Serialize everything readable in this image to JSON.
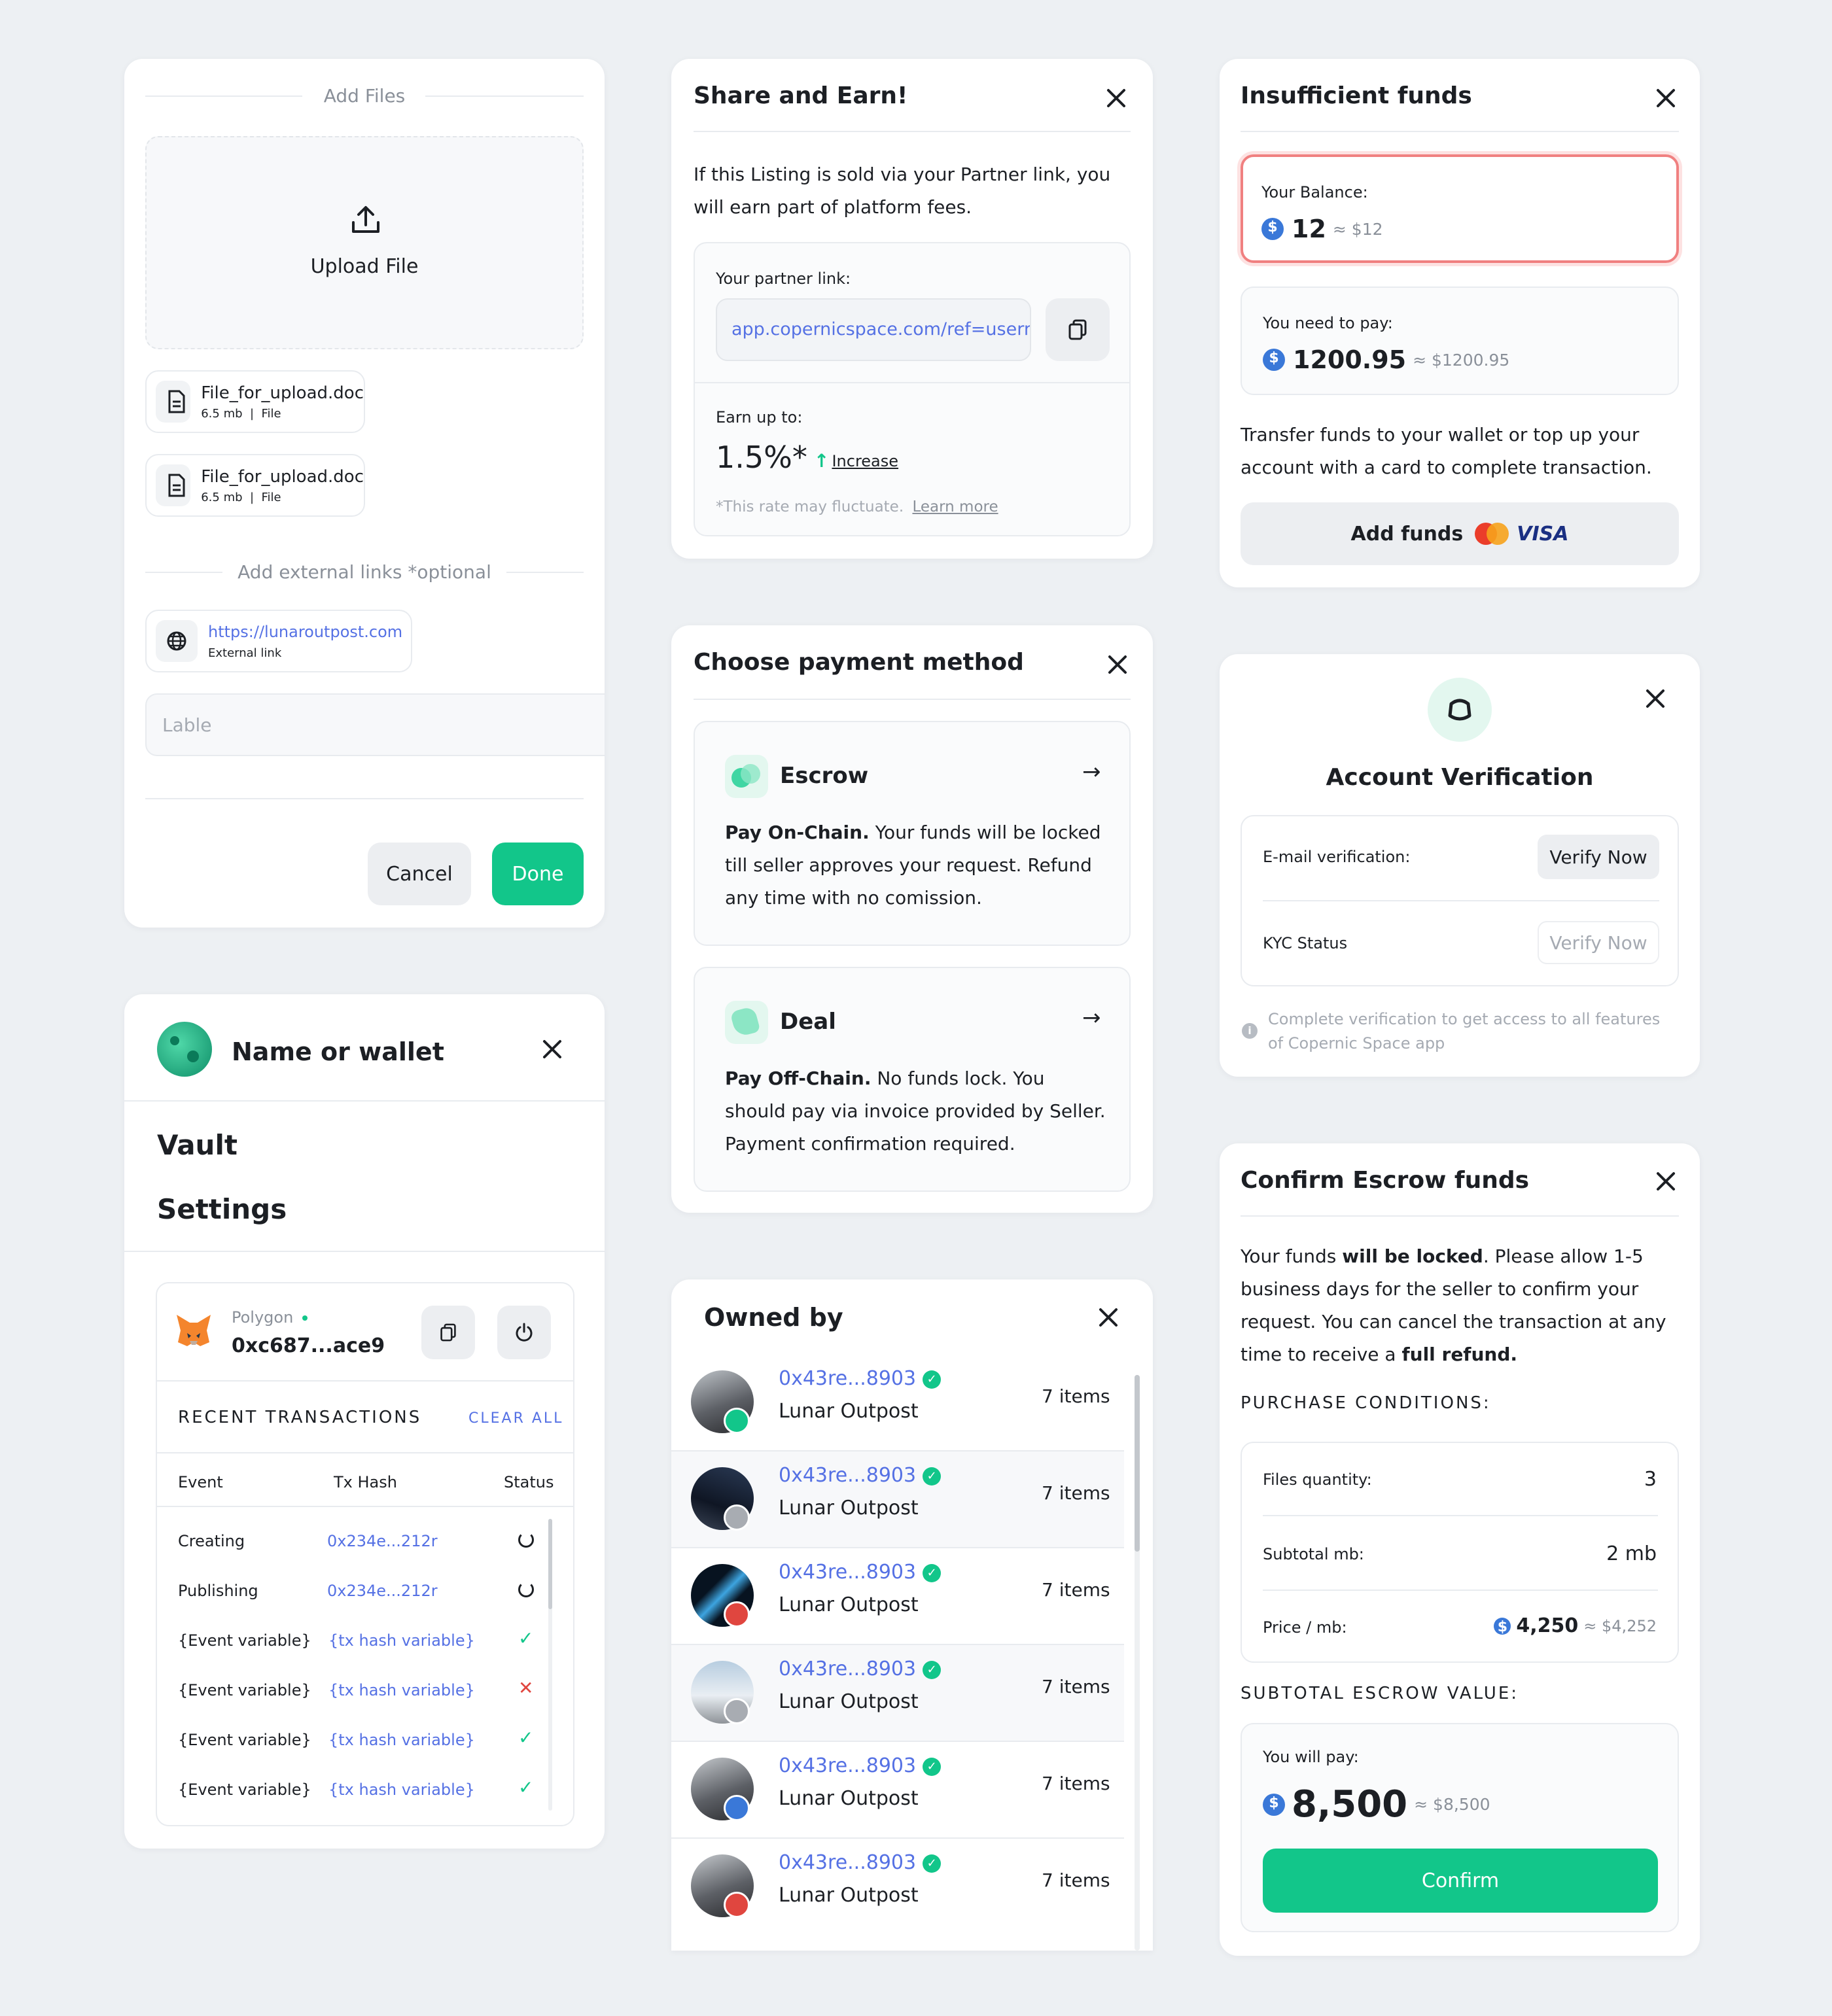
{
  "upload_card": {
    "add_files": "Add Files",
    "upload_file": "Upload File",
    "files": [
      {
        "name": "File_for_upload.doc",
        "size": "6.5 mb",
        "type": "File"
      },
      {
        "name": "File_for_upload.doc",
        "size": "6.5 mb",
        "type": "File"
      }
    ],
    "external_heading": "Add external links *optional",
    "link_url": "https://lunaroutpost.com",
    "link_caption": "External link",
    "label_placeholder": "Lable",
    "cancel": "Cancel",
    "done": "Done"
  },
  "share_card": {
    "title": "Share and Earn!",
    "body": "If this Listing is sold via your Partner link, you will earn part of platform fees.",
    "partner_label": "Your partner link:",
    "partner_link": "app.copernicspace.com/ref=usern",
    "earn_label": "Earn up to:",
    "rate": "1.5%*",
    "increase": "Increase",
    "note": "*This rate may fluctuate.",
    "learn_more": "Learn more"
  },
  "funds_card": {
    "title": "Insufficient funds",
    "balance_label": "Your Balance:",
    "balance_value": "12",
    "balance_usd": "≈ $12",
    "need_label": "You need to pay:",
    "need_value": "1200.95",
    "need_usd": "≈ $1200.95",
    "body": "Transfer funds to your wallet or top up your account with a card to complete transaction.",
    "add_funds": "Add funds",
    "visa": "VISA"
  },
  "payment_card": {
    "title": "Choose payment method",
    "methods": [
      {
        "name": "Escrow",
        "bold": "Pay On-Chain.",
        "text": " Your funds will be locked till seller approves your request. Refund any time with no comission."
      },
      {
        "name": "Deal",
        "bold": "Pay Off-Chain.",
        "text": " No funds lock. You should pay via invoice provided by Seller. Payment confirmation required."
      }
    ]
  },
  "verify_card": {
    "title": "Account Verification",
    "email_label": "E-mail verification:",
    "email_btn": "Verify Now",
    "kyc_label": "KYC Status",
    "kyc_btn": "Verify Now",
    "note": "Complete verification to get access to all features of Copernic Space app"
  },
  "wallet_card": {
    "title": "Name or wallet",
    "menu": [
      "Vault",
      "Settings"
    ],
    "network": "Polygon",
    "address": "0xc687...ace9",
    "recent": "RECENT TRANSACTIONS",
    "clear_all": "CLEAR ALL",
    "cols": [
      "Event",
      "Tx Hash",
      "Status"
    ],
    "rows": [
      {
        "event": "Creating",
        "hash": "0x234e...212r",
        "status": "pending"
      },
      {
        "event": "Publishing",
        "hash": "0x234e...212r",
        "status": "pending"
      },
      {
        "event": "{Event variable}",
        "hash": "{tx hash variable}",
        "status": "ok"
      },
      {
        "event": "{Event variable}",
        "hash": "{tx hash variable}",
        "status": "fail"
      },
      {
        "event": "{Event variable}",
        "hash": "{tx hash variable}",
        "status": "ok"
      },
      {
        "event": "{Event variable}",
        "hash": "{tx hash variable}",
        "status": "ok"
      }
    ]
  },
  "owned_card": {
    "title": "Owned by",
    "owners": [
      {
        "addr": "0x43re...8903",
        "name": "Lunar Outpost",
        "items": "7 items",
        "color": "#12c68a"
      },
      {
        "addr": "0x43re...8903",
        "name": "Lunar Outpost",
        "items": "7 items",
        "color": "#a8acb2"
      },
      {
        "addr": "0x43re...8903",
        "name": "Lunar Outpost",
        "items": "7 items",
        "color": "#e0463f"
      },
      {
        "addr": "0x43re...8903",
        "name": "Lunar Outpost",
        "items": "7 items",
        "color": "#a8acb2"
      },
      {
        "addr": "0x43re...8903",
        "name": "Lunar Outpost",
        "items": "7 items",
        "color": "#3a78d8"
      },
      {
        "addr": "0x43re...8903",
        "name": "Lunar Outpost",
        "items": "7 items",
        "color": "#e0463f"
      }
    ]
  },
  "escrow_card": {
    "title": "Confirm Escrow funds",
    "body_1": "Your funds ",
    "body_bold": "will be locked",
    "body_2": ". Please allow 1-5 business days for the seller to confirm your request. You can cancel the transaction at any time to receive a ",
    "body_bold2": "full refund.",
    "conditions_heading": "PURCHASE CONDITIONS:",
    "files_label": "Files quantity:",
    "files_value": "3",
    "subtotal_label": "Subtotal mb:",
    "subtotal_value": "2 mb",
    "price_label": "Price / mb:",
    "price_value": "4,250",
    "price_usd": "≈ $4,252",
    "escrow_heading": "SUBTOTAL ESCROW VALUE:",
    "pay_label": "You will pay:",
    "pay_value": "8,500",
    "pay_usd": "≈ $8,500",
    "confirm": "Confirm"
  },
  "colors": {
    "accent": "#12c68a",
    "link": "#5571e4",
    "error": "#e0463f"
  }
}
